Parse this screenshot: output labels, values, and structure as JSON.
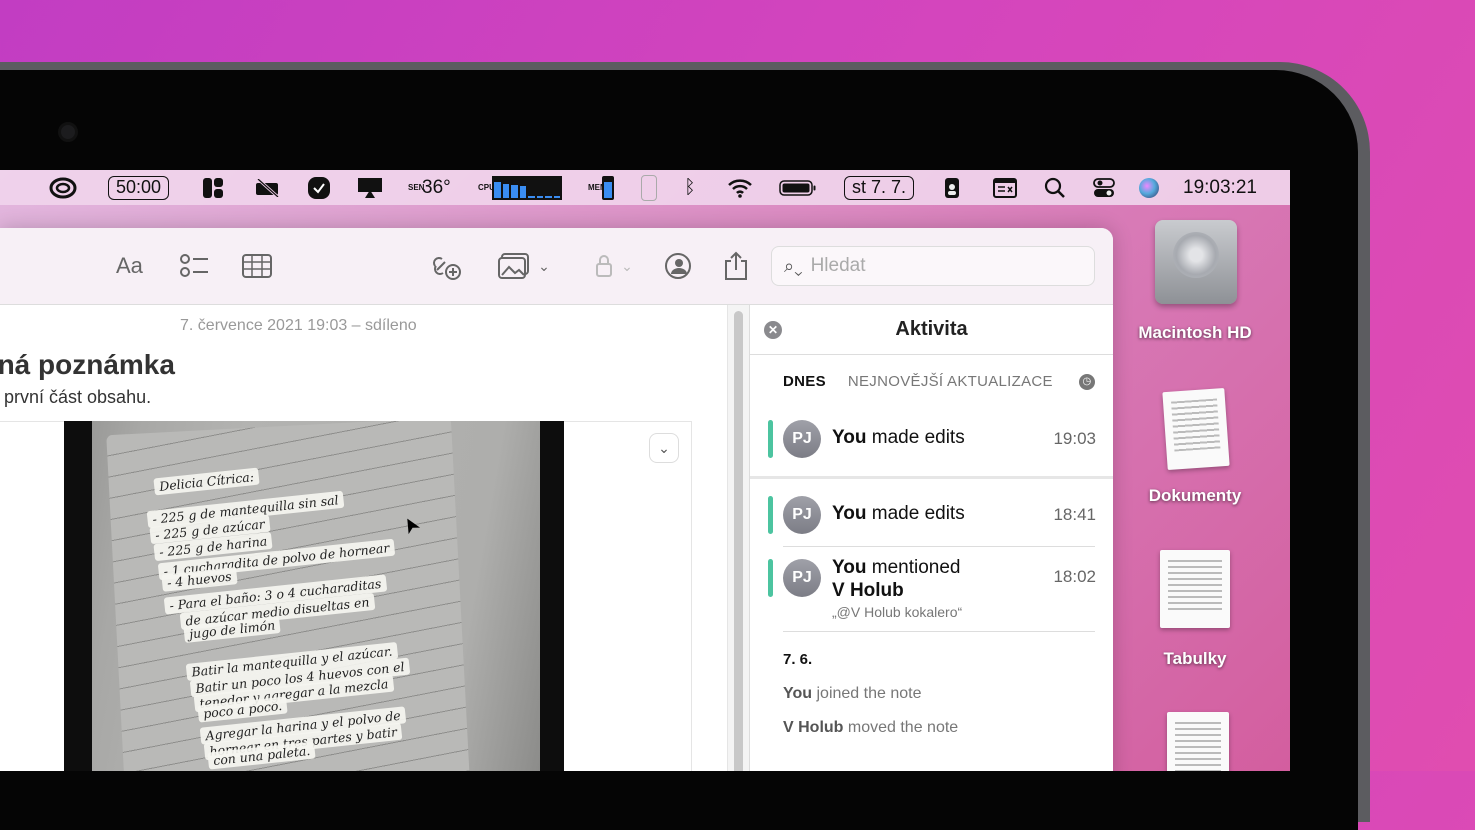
{
  "menubar": {
    "timer": "50:00",
    "sensor_label": "SEN",
    "temperature": "36°",
    "cpu_label": "CPU",
    "mem_label": "MEM",
    "date": "st 7. 7.",
    "clock": "19:03:21",
    "icons": [
      "creative-cloud-icon",
      "layout-icon",
      "camera-off-icon",
      "shield-check-icon",
      "airplay-icon",
      "cpu-meter",
      "memory-meter",
      "bluetooth-icon",
      "wifi-icon",
      "battery-icon",
      "contact-card-icon",
      "window-icon",
      "search-icon",
      "control-center-icon",
      "siri-icon"
    ]
  },
  "toolbar": {
    "format_label": "Aa",
    "search_placeholder": "Hledat"
  },
  "note": {
    "meta": "7. července 2021 19:03 – sdíleno",
    "title": "ená poznámka",
    "subtitle": "první část obsahu.",
    "handwriting": [
      "Delicia Cítrica:",
      "- 225 g de mantequilla sin sal",
      "- 225 g de azúcar",
      "- 225 g de harina",
      "- 1 cucharadita de polvo de hornear",
      "- 4 huevos",
      "- Para el baño: 3 o 4 cucharaditas",
      "de azúcar medio disueltas en",
      "jugo de limón",
      "Batir la mantequilla y el azúcar.",
      "Batir un poco los 4 huevos con el",
      "tenedor y agregar a la mezcla",
      "poco a poco.",
      "Agregar la harina y el polvo de",
      "hornear en tres partes y batir",
      "con una paleta."
    ]
  },
  "activity": {
    "title": "Aktivita",
    "tab_today": "DNES",
    "tab_latest": "NEJNOVĚJŠÍ AKTUALIZACE",
    "items": [
      {
        "avatar": "PJ",
        "actor": "You",
        "action": "made edits",
        "time": "19:03"
      },
      {
        "avatar": "PJ",
        "actor": "You",
        "action": "made edits",
        "time": "18:41"
      },
      {
        "avatar": "PJ",
        "actor": "You",
        "action": "mentioned",
        "target": "V Holub",
        "quote": "„@V Holub kokalero“",
        "time": "18:02"
      }
    ],
    "day_header": "7. 6.",
    "history": [
      {
        "actor": "You",
        "action": "joined the note"
      },
      {
        "actor": "V Holub",
        "action": "moved the note"
      }
    ]
  },
  "desktop": {
    "icons": [
      "Macintosh HD",
      "Dokumenty",
      "Tabulky"
    ]
  },
  "colors": {
    "accent": "#4cc4a0",
    "wallpaper": "#d445bd"
  }
}
